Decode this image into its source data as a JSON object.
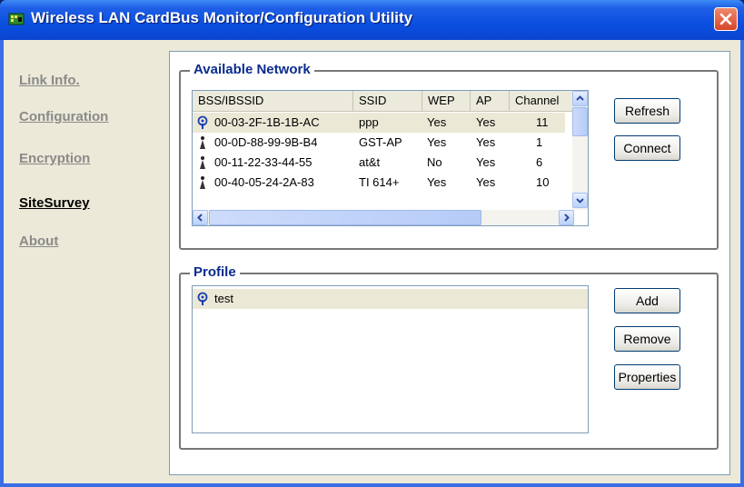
{
  "window": {
    "title": "Wireless LAN CardBus Monitor/Configuration Utility"
  },
  "nav": {
    "items": [
      {
        "label": "Link Info."
      },
      {
        "label": "Configuration"
      },
      {
        "label": "Encryption"
      },
      {
        "label": "SiteSurvey",
        "active": true
      },
      {
        "label": "About"
      }
    ]
  },
  "available": {
    "title": "Available Network",
    "columns": [
      "BSS/IBSSID",
      "SSID",
      "WEP",
      "AP",
      "Channel"
    ],
    "rows": [
      {
        "icon": "access-point-icon",
        "bssid": "00-03-2F-1B-1B-AC",
        "ssid": "ppp",
        "wep": "Yes",
        "ap": "Yes",
        "channel": "11"
      },
      {
        "icon": "signal-antenna-icon",
        "bssid": "00-0D-88-99-9B-B4",
        "ssid": "GST-AP",
        "wep": "Yes",
        "ap": "Yes",
        "channel": "1"
      },
      {
        "icon": "signal-antenna-icon",
        "bssid": "00-11-22-33-44-55",
        "ssid": "at&t",
        "wep": "No",
        "ap": "Yes",
        "channel": "6"
      },
      {
        "icon": "signal-antenna-icon",
        "bssid": "00-40-05-24-2A-83",
        "ssid": "TI 614+",
        "wep": "Yes",
        "ap": "Yes",
        "channel": "10"
      }
    ],
    "refresh_label": "Refresh",
    "connect_label": "Connect"
  },
  "profile": {
    "title": "Profile",
    "items": [
      {
        "icon": "access-point-icon",
        "name": "test"
      }
    ],
    "add_label": "Add",
    "remove_label": "Remove",
    "properties_label": "Properties"
  },
  "colors": {
    "title_bar": "#0a4fe0",
    "group_title": "#0b2b8f",
    "nav_active": "#000000",
    "nav_inactive": "#8a8a8a"
  }
}
